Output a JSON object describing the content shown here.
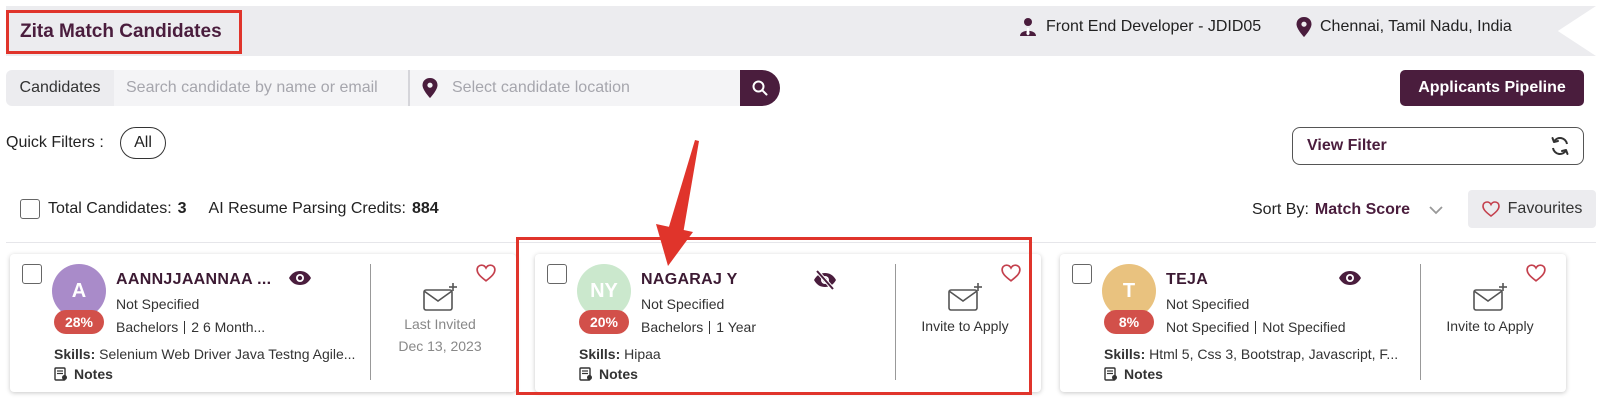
{
  "header": {
    "title": "Zita Match Candidates",
    "job": "Front End Developer - JDID05",
    "location": "Chennai, Tamil Nadu, India"
  },
  "search": {
    "tab_label": "Candidates",
    "name_placeholder": "Search candidate by name or email",
    "location_placeholder": "Select candidate location",
    "pipeline_button": "Applicants Pipeline"
  },
  "filters": {
    "quick_label": "Quick Filters :",
    "chip_all": "All",
    "view_filter": "View Filter"
  },
  "summary": {
    "total_label": "Total Candidates:",
    "total_value": "3",
    "credits_label": "AI Resume Parsing Credits:",
    "credits_value": "884",
    "sort_label": "Sort By:",
    "sort_value": "Match Score",
    "favourites": "Favourites"
  },
  "cards": [
    {
      "initials": "A",
      "avatar_color": "#a98bc9",
      "name": "AANNJJAANNAA ...",
      "location": "Not Specified",
      "education": "Bachelors",
      "experience": "2 6 Month...",
      "score": "28%",
      "skills_label": "Skills:",
      "skills": "Selenium Web Driver Java Testng Agile...",
      "notes": "Notes",
      "action_label": "Last Invited",
      "action_date": "Dec 13, 2023"
    },
    {
      "initials": "NY",
      "avatar_color": "#cbe8cd",
      "name": "NAGARAJ Y",
      "location": "Not Specified",
      "education": "Bachelors",
      "experience": "1 Year",
      "score": "20%",
      "skills_label": "Skills:",
      "skills": "Hipaa",
      "notes": "Notes",
      "action_label": "Invite to Apply"
    },
    {
      "initials": "T",
      "avatar_color": "#e9c27f",
      "name": "TEJA",
      "location": "Not Specified",
      "education": "Not Specified",
      "experience": "Not Specified",
      "score": "8%",
      "skills_label": "Skills:",
      "skills": "Html 5, Css 3, Bootstrap, Javascript, F...",
      "notes": "Notes",
      "action_label": "Invite to Apply"
    }
  ],
  "colors": {
    "brand": "#4a1d3d",
    "score_badge": "#d2504a",
    "annotation_red": "#e0342b",
    "heart": "#c4404d"
  },
  "icons": [
    "user-tie-icon",
    "location-pin-icon",
    "search-icon",
    "refresh-icon",
    "chevron-down-icon",
    "heart-icon",
    "eye-icon",
    "eye-slash-icon",
    "mail-plus-icon",
    "notes-icon"
  ]
}
